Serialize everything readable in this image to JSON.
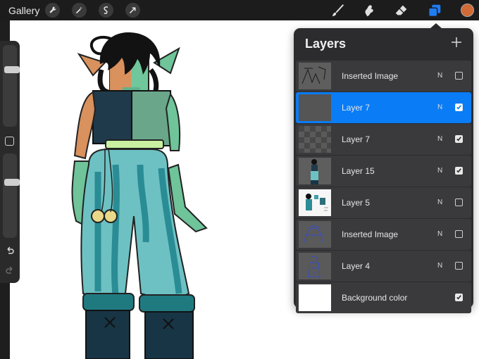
{
  "topbar": {
    "gallery_label": "Gallery",
    "left_tools": [
      "wrench-icon",
      "magic-wand-icon",
      "selection-icon",
      "transform-arrow-icon"
    ],
    "right_tools": [
      "brush-icon",
      "smudge-icon",
      "eraser-icon",
      "layers-icon"
    ],
    "current_color": "#d06a37",
    "active_tool_color": "#1f7cf3"
  },
  "sidebar": {
    "brush_size_level": 0.28,
    "opacity_level": 0.33
  },
  "layers_panel": {
    "title": "Layers",
    "add_button": "+",
    "layers": [
      {
        "name": "Inserted Image",
        "mode": "N",
        "visible": false,
        "selected": false,
        "thumb": "sketch"
      },
      {
        "name": "Layer 7",
        "mode": "N",
        "visible": true,
        "selected": true,
        "thumb": "dark"
      },
      {
        "name": "Layer 7",
        "mode": "N",
        "visible": true,
        "selected": false,
        "thumb": "transparent"
      },
      {
        "name": "Layer 15",
        "mode": "N",
        "visible": true,
        "selected": false,
        "thumb": "figure"
      },
      {
        "name": "Layer 5",
        "mode": "N",
        "visible": false,
        "selected": false,
        "thumb": "reference"
      },
      {
        "name": "Inserted Image",
        "mode": "N",
        "visible": false,
        "selected": false,
        "thumb": "blue-sketch"
      },
      {
        "name": "Layer 4",
        "mode": "N",
        "visible": false,
        "selected": false,
        "thumb": "blue-sketch-2"
      },
      {
        "name": "Background color",
        "mode": "",
        "visible": true,
        "selected": false,
        "thumb": "white"
      }
    ]
  }
}
